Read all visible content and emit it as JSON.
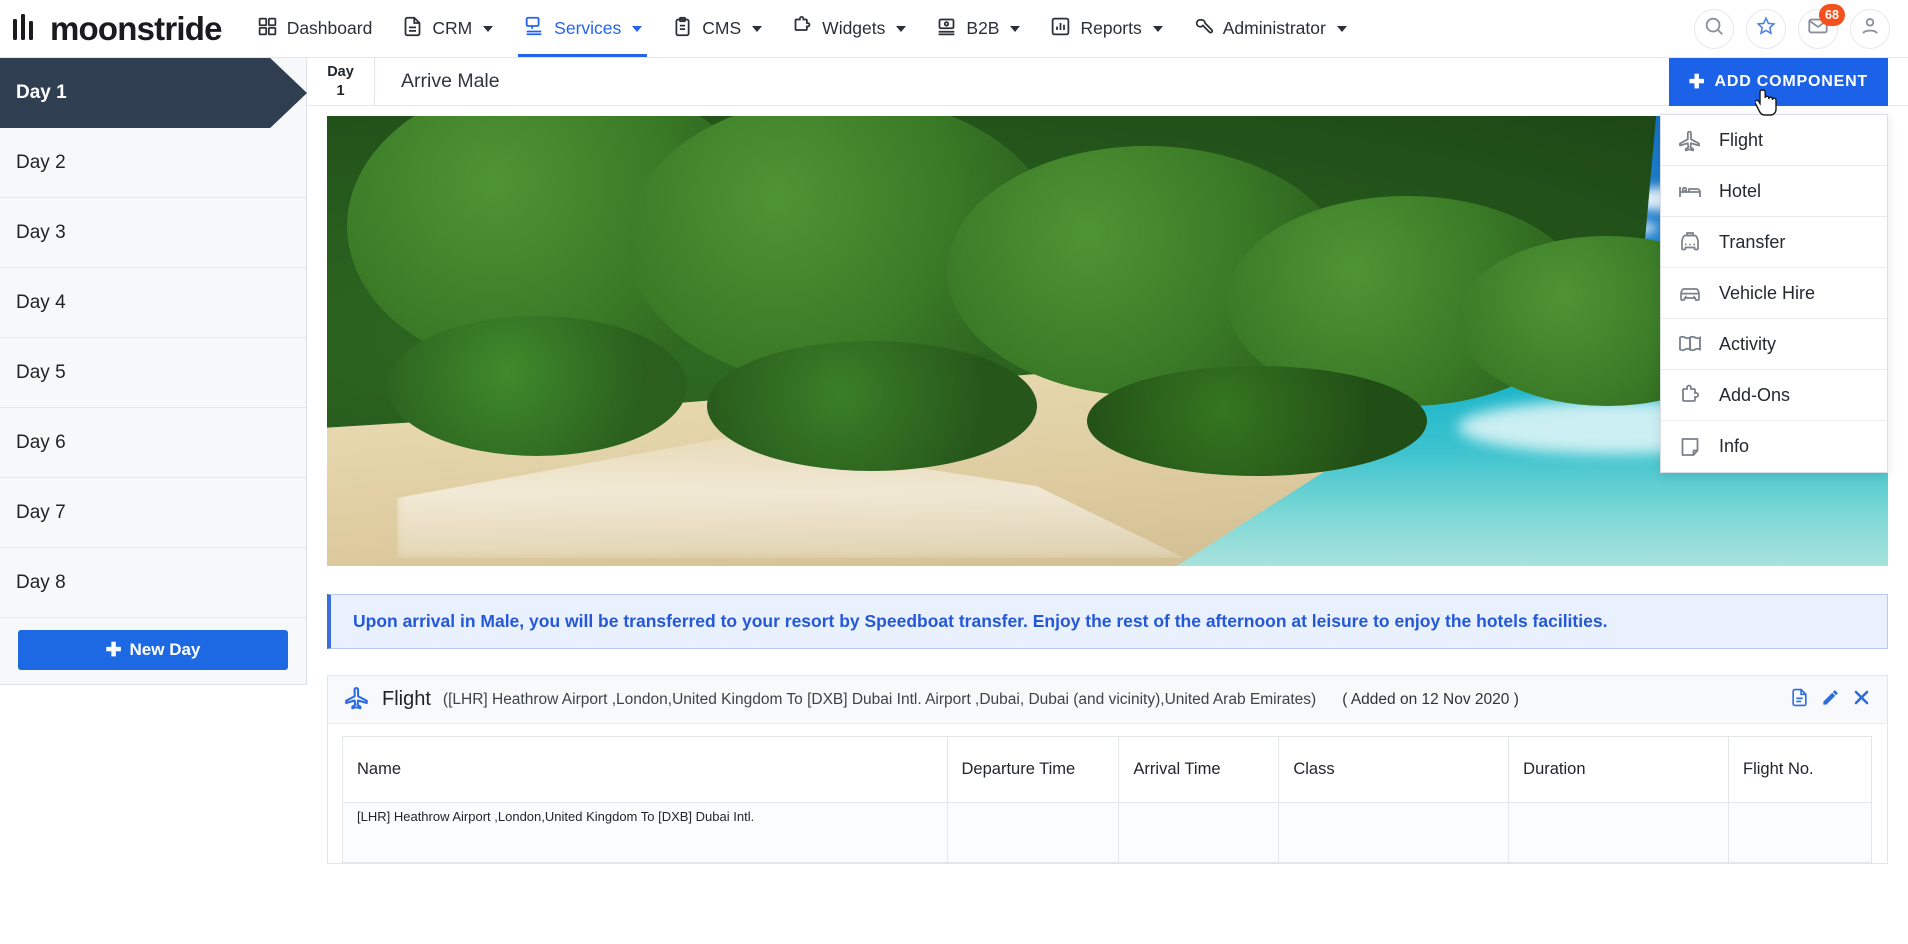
{
  "brand": {
    "name": "moonstride",
    "logo_icon": "bar-logo-icon"
  },
  "topnav": {
    "items": [
      {
        "label": "Dashboard",
        "icon": "grid-icon",
        "has_caret": false,
        "active": false
      },
      {
        "label": "CRM",
        "icon": "document-icon",
        "has_caret": true,
        "active": false
      },
      {
        "label": "Services",
        "icon": "services-icon",
        "has_caret": true,
        "active": true
      },
      {
        "label": "CMS",
        "icon": "clipboard-icon",
        "has_caret": true,
        "active": false
      },
      {
        "label": "Widgets",
        "icon": "puzzle-icon",
        "has_caret": true,
        "active": false
      },
      {
        "label": "B2B",
        "icon": "b2b-icon",
        "has_caret": true,
        "active": false
      },
      {
        "label": "Reports",
        "icon": "chart-bar-icon",
        "has_caret": true,
        "active": false
      },
      {
        "label": "Administrator",
        "icon": "wrench-icon",
        "has_caret": true,
        "active": false
      }
    ],
    "actions": [
      {
        "name": "search-icon",
        "badge": null
      },
      {
        "name": "star-icon",
        "badge": null
      },
      {
        "name": "mail-icon",
        "badge": "68"
      },
      {
        "name": "user-avatar-icon",
        "badge": null
      }
    ],
    "accent_color": "#2463eb",
    "badge_color": "#f4511e"
  },
  "days_panel": {
    "days": [
      {
        "label": "Day 1",
        "active": true
      },
      {
        "label": "Day 2",
        "active": false
      },
      {
        "label": "Day 3",
        "active": false
      },
      {
        "label": "Day 4",
        "active": false
      },
      {
        "label": "Day 5",
        "active": false
      },
      {
        "label": "Day 6",
        "active": false
      },
      {
        "label": "Day 7",
        "active": false
      },
      {
        "label": "Day 8",
        "active": false
      }
    ],
    "new_day_label": "New Day",
    "active_bg": "#2f3e50",
    "button_color": "#1c69e3"
  },
  "day_header": {
    "badge_word": "Day",
    "badge_number": "1",
    "title": "Arrive Male",
    "add_component_label": "ADD COMPONENT"
  },
  "component_menu": {
    "items": [
      {
        "label": "Flight",
        "icon": "plane-icon"
      },
      {
        "label": "Hotel",
        "icon": "bed-icon"
      },
      {
        "label": "Transfer",
        "icon": "taxi-icon"
      },
      {
        "label": "Vehicle Hire",
        "icon": "car-icon"
      },
      {
        "label": "Activity",
        "icon": "book-icon"
      },
      {
        "label": "Add-Ons",
        "icon": "puzzle-icon"
      },
      {
        "label": "Info",
        "icon": "note-icon"
      }
    ]
  },
  "hero": {
    "alt": "tropical-beach-palm-trees-turquoise-sea"
  },
  "info_banner": {
    "text": "Upon arrival in Male, you will be transferred to your resort by Speedboat transfer. Enjoy the rest of the afternoon at leisure to enjoy the hotels facilities."
  },
  "flight_card": {
    "label": "Flight",
    "route": "([LHR] Heathrow Airport ,London,United Kingdom To [DXB] Dubai Intl. Airport ,Dubai, Dubai (and vicinity),United Arab Emirates)",
    "added": "( Added on 12 Nov 2020 )",
    "actions": [
      {
        "name": "document-icon"
      },
      {
        "name": "edit-pencil-icon"
      },
      {
        "name": "delete-close-icon"
      }
    ],
    "columns": [
      "Name",
      "Departure Time",
      "Arrival Time",
      "Class",
      "Duration",
      "Flight No."
    ],
    "rows": [
      {
        "name": "[LHR] Heathrow Airport ,London,United Kingdom To [DXB] Dubai Intl.",
        "departure_time": "",
        "arrival_time": "",
        "class": "",
        "duration": "",
        "flight_no": ""
      }
    ]
  }
}
